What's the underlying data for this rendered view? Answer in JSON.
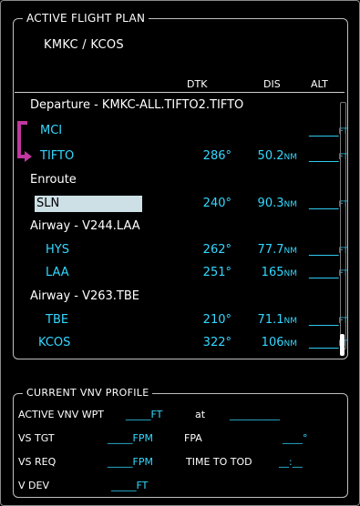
{
  "flight_plan": {
    "title": "ACTIVE FLIGHT PLAN",
    "route": "KMKC / KCOS",
    "columns": {
      "dtk": "DTK",
      "dis": "DIS",
      "alt": "ALT"
    },
    "rows": [
      {
        "kind": "header",
        "name": "Departure - KMKC-ALL.TIFTO2.TIFTO"
      },
      {
        "kind": "waypoint",
        "name": "MCI",
        "dtk": "",
        "dis": "",
        "dis_unit": "",
        "alt": "_____",
        "alt_unit": "FT"
      },
      {
        "kind": "waypoint",
        "name": "TIFTO",
        "dtk": "286°",
        "dis": "50.2",
        "dis_unit": "NM",
        "alt": "_____",
        "alt_unit": "FT"
      },
      {
        "kind": "header",
        "name": "Enroute"
      },
      {
        "kind": "waypoint",
        "name": "SLN",
        "dtk": "240°",
        "dis": "90.3",
        "dis_unit": "NM",
        "alt": "_____",
        "alt_unit": "FT",
        "selected": true
      },
      {
        "kind": "header",
        "name": "Airway - V244.LAA"
      },
      {
        "kind": "waypoint",
        "name": "HYS",
        "dtk": "262°",
        "dis": "77.7",
        "dis_unit": "NM",
        "alt": "_____",
        "alt_unit": "FT"
      },
      {
        "kind": "waypoint",
        "name": "LAA",
        "dtk": "251°",
        "dis": "165",
        "dis_unit": "NM",
        "alt": "_____",
        "alt_unit": "FT"
      },
      {
        "kind": "header",
        "name": "Airway - V263.TBE"
      },
      {
        "kind": "waypoint",
        "name": "TBE",
        "dtk": "210°",
        "dis": "71.1",
        "dis_unit": "NM",
        "alt": "_____",
        "alt_unit": "FT"
      },
      {
        "kind": "waypoint",
        "name": "KCOS",
        "dtk": "322°",
        "dis": "106",
        "dis_unit": "NM",
        "alt": "_____",
        "alt_unit": "FT"
      }
    ]
  },
  "vnv": {
    "title": "CURRENT VNV PROFILE",
    "active_wpt_label": "ACTIVE VNV WPT",
    "active_wpt_alt": "_____FT",
    "active_wpt_at": "at",
    "active_wpt_name": "__________",
    "vs_tgt_label": "VS TGT",
    "vs_tgt_value": "_____FPM",
    "fpa_label": "FPA",
    "fpa_value": "____°",
    "vs_req_label": "VS REQ",
    "vs_req_value": "_____FPM",
    "time_to_tod_label": "TIME TO TOD",
    "time_to_tod_value": "__:__",
    "v_dev_label": "V DEV",
    "v_dev_value": "_____FT"
  },
  "colors": {
    "text": "#ffffff",
    "cyan": "#34d8ff",
    "magenta": "#c0389f",
    "selection": "#cde0e6"
  }
}
